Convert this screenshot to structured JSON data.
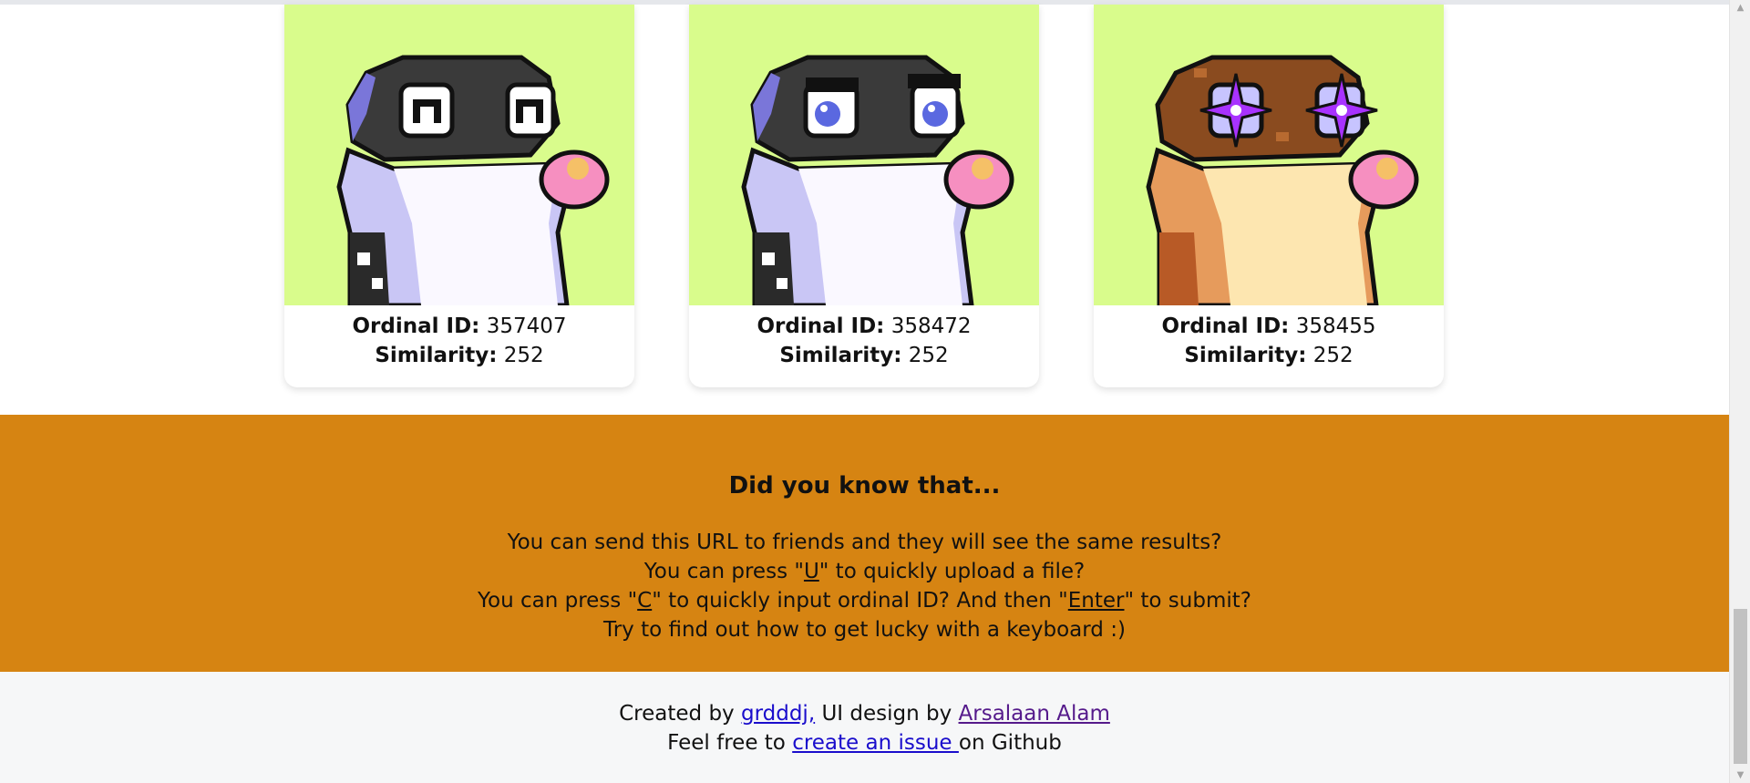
{
  "cards": [
    {
      "id_label": "Ordinal ID:",
      "id_value": "357407",
      "sim_label": "Similarity:",
      "sim_value": "252",
      "art": "frog-black-white-eyes-icon"
    },
    {
      "id_label": "Ordinal ID:",
      "id_value": "358472",
      "sim_label": "Similarity:",
      "sim_value": "252",
      "art": "frog-black-blue-eyes-icon"
    },
    {
      "id_label": "Ordinal ID:",
      "id_value": "358455",
      "sim_label": "Similarity:",
      "sim_value": "252",
      "art": "frog-brown-star-eyes-icon"
    }
  ],
  "did_you_know": {
    "title": "Did you know that...",
    "line1": "You can send this URL to friends and they will see the same results?",
    "line2_pre": "You can press \"",
    "line2_key": "U",
    "line2_post": "\" to quickly upload a file?",
    "line3_pre": "You can press \"",
    "line3_key1": "C",
    "line3_mid": "\" to quickly input ordinal ID? And then \"",
    "line3_key2": "Enter",
    "line3_post": "\" to submit?",
    "line4": "Try to find out how to get lucky with a keyboard :)"
  },
  "footer": {
    "created_by": "Created by ",
    "author_link": "grdddj,",
    "ui_design_by": " UI design by ",
    "designer_link": "Arsalaan Alam",
    "feel_free": "Feel free to ",
    "issue_link": "create an issue ",
    "on_github": "on Github"
  },
  "colors": {
    "card_bg": "#d9fc8c",
    "banner_bg": "#d68412",
    "footer_bg": "#f6f7f8",
    "link": "#1a0dcc",
    "visited_link": "#551a8b"
  }
}
